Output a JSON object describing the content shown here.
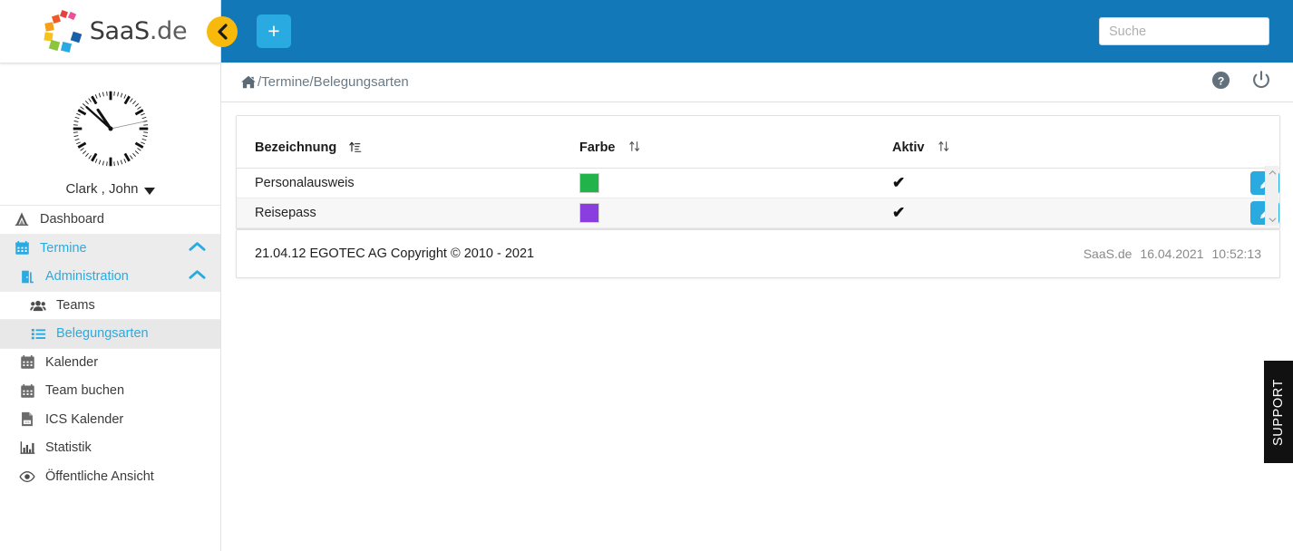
{
  "brand": {
    "name_main": "SaaS",
    "name_suffix": ".de",
    "logo_colors": [
      "#e8413c",
      "#ef4e9b",
      "#f6a01a",
      "#f6c31a",
      "#8cc63f",
      "#39b54a",
      "#29abe2",
      "#1b5fa8",
      "#2a3f8f"
    ]
  },
  "topbar": {
    "collapse_icon": "chevron-left-icon",
    "add_label": "+",
    "search": {
      "placeholder": "Suche",
      "value": ""
    },
    "background": "#1278b8",
    "collapse_color": "#f7b90b",
    "add_color": "#29abe2"
  },
  "breadcrumb": {
    "home_icon": "home-icon",
    "path": "/Termine/Belegungsarten",
    "actions": [
      {
        "name": "help-icon",
        "title": "?"
      },
      {
        "name": "power-icon",
        "title": ""
      }
    ]
  },
  "sidebar": {
    "user": {
      "name": "Clark , John",
      "clock_time": "10:52:13",
      "clock_hour": 10,
      "clock_minute": 52,
      "clock_second": 13
    },
    "items": [
      {
        "label": "Dashboard",
        "icon": "dashboard-tent-icon",
        "level": 0,
        "state": "normal",
        "chevron": ""
      },
      {
        "label": "Termine",
        "icon": "calendar-icon",
        "level": 0,
        "state": "expanded",
        "chevron": "chevron-up-icon"
      },
      {
        "label": "Administration",
        "icon": "door-icon",
        "level": 1,
        "state": "expanded",
        "chevron": "chevron-up-icon"
      },
      {
        "label": "Teams",
        "icon": "users-icon",
        "level": 2,
        "state": "normal",
        "chevron": ""
      },
      {
        "label": "Belegungsarten",
        "icon": "list-icon",
        "level": 2,
        "state": "selected",
        "chevron": ""
      },
      {
        "label": "Kalender",
        "icon": "calendar-grey-icon",
        "level": 1,
        "state": "normal",
        "chevron": ""
      },
      {
        "label": "Team buchen",
        "icon": "calendar-grey-icon",
        "level": 1,
        "state": "normal",
        "chevron": ""
      },
      {
        "label": "ICS Kalender",
        "icon": "file-ics-icon",
        "level": 1,
        "state": "normal",
        "chevron": ""
      },
      {
        "label": "Statistik",
        "icon": "bar-chart-icon",
        "level": 1,
        "state": "normal",
        "chevron": ""
      },
      {
        "label": "Öffentliche Ansicht",
        "icon": "eye-icon",
        "level": 1,
        "state": "normal",
        "chevron": ""
      }
    ]
  },
  "table": {
    "columns": [
      {
        "label": "Bezeichnung",
        "sort_icon": "sort-alpha-asc-icon"
      },
      {
        "label": "Farbe",
        "sort_icon": "sort-updown-icon"
      },
      {
        "label": "Aktiv",
        "sort_icon": "sort-updown-icon"
      }
    ],
    "rows": [
      {
        "bezeichnung": "Personalausweis",
        "farbe": "#22b44a",
        "aktiv": "✔",
        "action_icon": "pencil-edit-icon"
      },
      {
        "bezeichnung": "Reisepass",
        "farbe": "#8a3ee0",
        "aktiv": "✔",
        "action_icon": "pencil-edit-icon"
      }
    ],
    "scrollbar": {
      "up_icon": "chevron-up-small-icon",
      "down_icon": "chevron-down-small-icon"
    }
  },
  "footer": {
    "left": "21.04.12 EGOTEC AG Copyright © 2010 - 2021",
    "right_brand": "SaaS.de",
    "right_date": "16.04.2021",
    "right_time": "10:52:13"
  },
  "support": {
    "label": "SUPPORT"
  }
}
